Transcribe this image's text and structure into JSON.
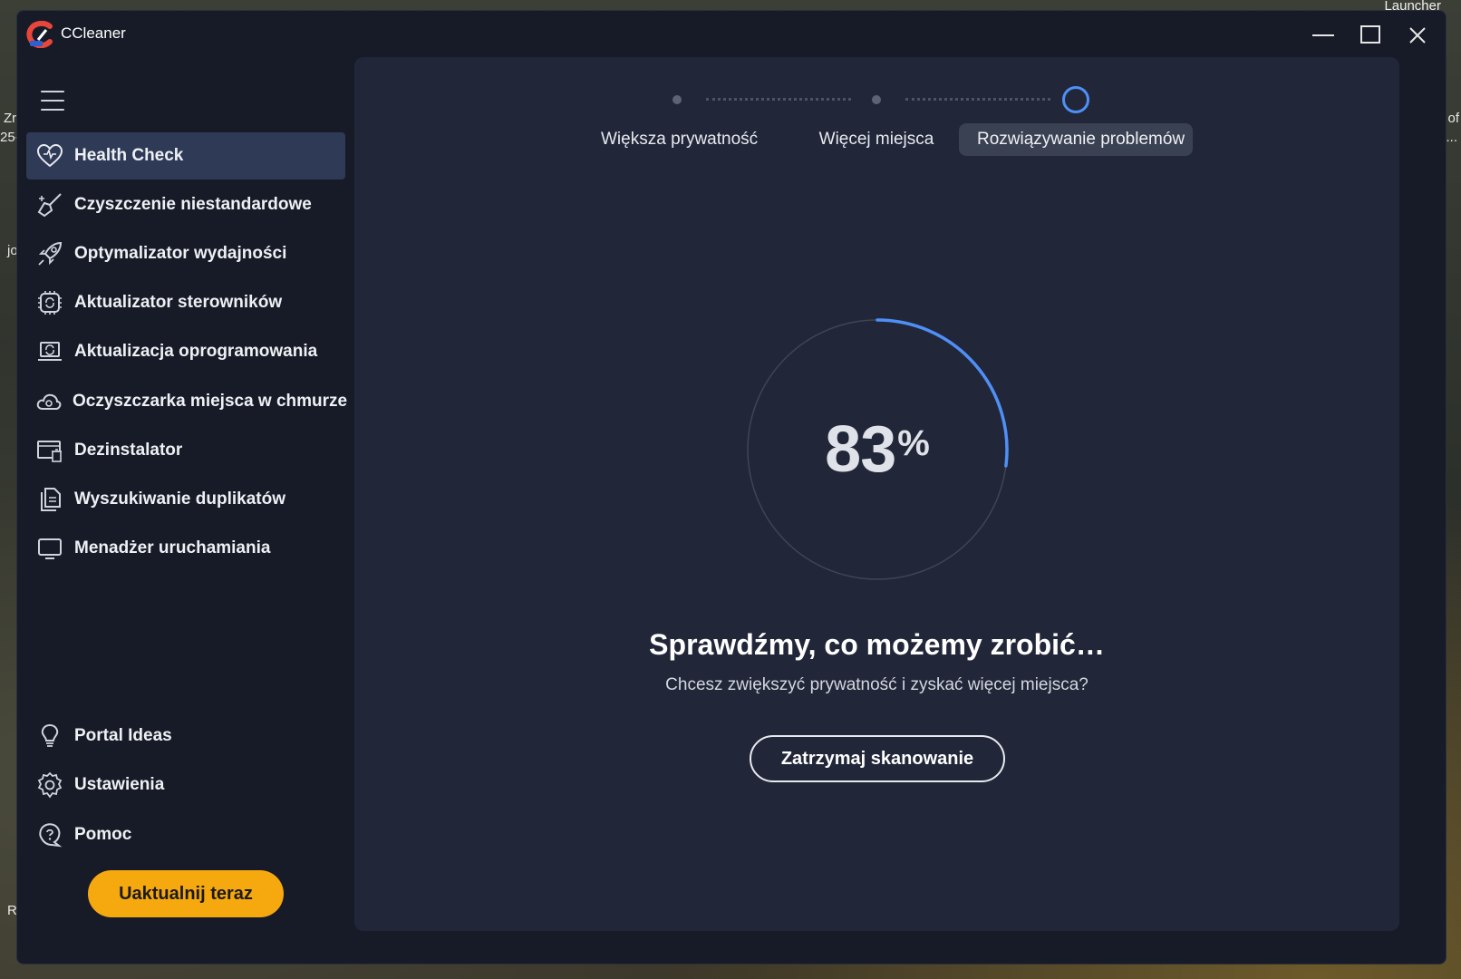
{
  "desktop": {
    "launcher_text": "Launcher",
    "left_fragment_1": "Zr",
    "left_fragment_2": "25-",
    "right_fragment_1": "of",
    "right_fragment_2": "...",
    "left_fragment_3": "jo",
    "left_fragment_4": "R"
  },
  "window": {
    "title": "CCleaner",
    "controls": [
      "minimize",
      "maximize",
      "close"
    ]
  },
  "sidebar": {
    "items": [
      {
        "label": "Health Check",
        "icon": "heart-icon",
        "active": true
      },
      {
        "label": "Czyszczenie niestandardowe",
        "icon": "broom-sparkle-icon"
      },
      {
        "label": "Optymalizator wydajności",
        "icon": "rocket-icon"
      },
      {
        "label": "Aktualizator sterowników",
        "icon": "chip-refresh-icon"
      },
      {
        "label": "Aktualizacja oprogramowania",
        "icon": "laptop-refresh-icon"
      },
      {
        "label": "Oczyszczarka miejsca w chmurze",
        "icon": "cloud-gear-icon"
      },
      {
        "label": "Dezinstalator",
        "icon": "uninstall-icon"
      },
      {
        "label": "Wyszukiwanie duplikatów",
        "icon": "duplicate-files-icon"
      },
      {
        "label": "Menadżer uruchamiania",
        "icon": "monitor-icon"
      }
    ],
    "bottom_items": [
      {
        "label": "Portal Ideas",
        "icon": "lightbulb-icon"
      },
      {
        "label": "Ustawienia",
        "icon": "gear-icon"
      },
      {
        "label": "Pomoc",
        "icon": "help-icon"
      }
    ],
    "upgrade_label": "Uaktualnij teraz"
  },
  "steps": {
    "items": [
      {
        "label": "Większa prywatność",
        "state": "done"
      },
      {
        "label": "Więcej miejsca",
        "state": "done"
      },
      {
        "label": "Rozwiązywanie problemów",
        "state": "current"
      }
    ]
  },
  "progress": {
    "value": 83,
    "unit": "%",
    "fraction": 0.27
  },
  "main": {
    "headline": "Sprawdźmy, co możemy zrobić…",
    "subline": "Chcesz zwiększyć prywatność i zyskać więcej miejsca?",
    "stop_label": "Zatrzymaj skanowanie"
  },
  "colors": {
    "accent_blue": "#4f8ff7",
    "upgrade_orange": "#f6a80f",
    "active_nav": "#2e3a56",
    "panel": "#212739",
    "sidebar": "#171b27"
  }
}
